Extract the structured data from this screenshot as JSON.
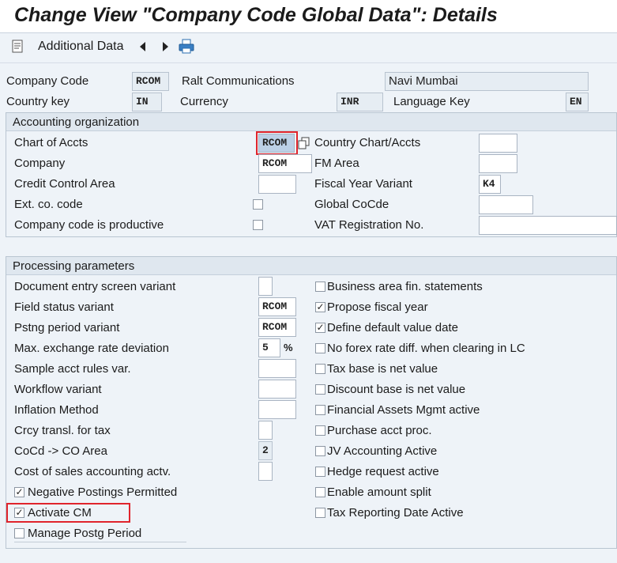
{
  "window": {
    "title": "Change View \"Company Code Global Data\": Details"
  },
  "toolbar": {
    "additional_data": "Additional Data",
    "icons": [
      "document-icon",
      "prev-icon",
      "next-icon",
      "printer-icon"
    ]
  },
  "header": {
    "company_code_label": "Company Code",
    "company_code_value": "RCOM",
    "company_name": "Ralt Communications",
    "city": "Navi Mumbai",
    "country_key_label": "Country key",
    "country_key_value": "IN",
    "currency_label": "Currency",
    "currency_value": "INR",
    "language_key_label": "Language Key",
    "language_key_value": "EN"
  },
  "accounting": {
    "title": "Accounting organization",
    "chart_of_accts_label": "Chart of Accts",
    "chart_of_accts_value": "RCOM",
    "country_chart_label": "Country Chart/Accts",
    "country_chart_value": "",
    "company_label": "Company",
    "company_value": "RCOM",
    "fm_area_label": "FM Area",
    "fm_area_value": "",
    "credit_control_label": "Credit Control Area",
    "credit_control_value": "",
    "fiscal_year_variant_label": "Fiscal Year Variant",
    "fiscal_year_variant_value": "K4",
    "ext_co_code_label": "Ext. co. code",
    "global_cocde_label": "Global CoCde",
    "global_cocde_value": "",
    "productive_label": "Company code is productive",
    "vat_label": "VAT Registration No.",
    "vat_value": ""
  },
  "processing": {
    "title": "Processing parameters",
    "doc_entry_label": "Document entry screen variant",
    "doc_entry_value": "",
    "field_status_label": "Field status variant",
    "field_status_value": "RCOM",
    "pstng_period_label": "Pstng period variant",
    "pstng_period_value": "RCOM",
    "max_exchange_label": "Max. exchange rate deviation",
    "max_exchange_value": "5",
    "max_exchange_unit": "%",
    "sample_acct_label": "Sample acct rules var.",
    "sample_acct_value": "",
    "workflow_label": "Workflow variant",
    "workflow_value": "",
    "inflation_label": "Inflation Method",
    "inflation_value": "",
    "crcy_transl_label": "Crcy transl. for tax",
    "crcy_transl_value": "",
    "cocd_co_label": "CoCd -> CO Area",
    "cocd_co_value": "2",
    "cost_of_sales_label": "Cost of sales accounting actv.",
    "cost_of_sales_value": "",
    "neg_postings_label": "Negative Postings Permitted",
    "activate_cm_label": "Activate CM",
    "manage_postg_label": "Manage Postg Period",
    "right_options": [
      {
        "label": "Business area fin. statements",
        "checked": false
      },
      {
        "label": "Propose fiscal year",
        "checked": true
      },
      {
        "label": "Define default value date",
        "checked": true
      },
      {
        "label": "No forex rate diff. when clearing in LC",
        "checked": false
      },
      {
        "label": "Tax base is net value",
        "checked": false
      },
      {
        "label": "Discount base is net value",
        "checked": false
      },
      {
        "label": "Financial Assets Mgmt active",
        "checked": false
      },
      {
        "label": "Purchase acct proc.",
        "checked": false
      },
      {
        "label": "JV Accounting Active",
        "checked": false
      },
      {
        "label": "Hedge request active",
        "checked": false
      },
      {
        "label": "Enable amount split",
        "checked": false
      },
      {
        "label": "Tax Reporting Date Active",
        "checked": false
      }
    ],
    "check_mark": "✓"
  },
  "colors": {
    "highlight_border": "#e0242c",
    "field_highlight": "#bcd0e6"
  }
}
